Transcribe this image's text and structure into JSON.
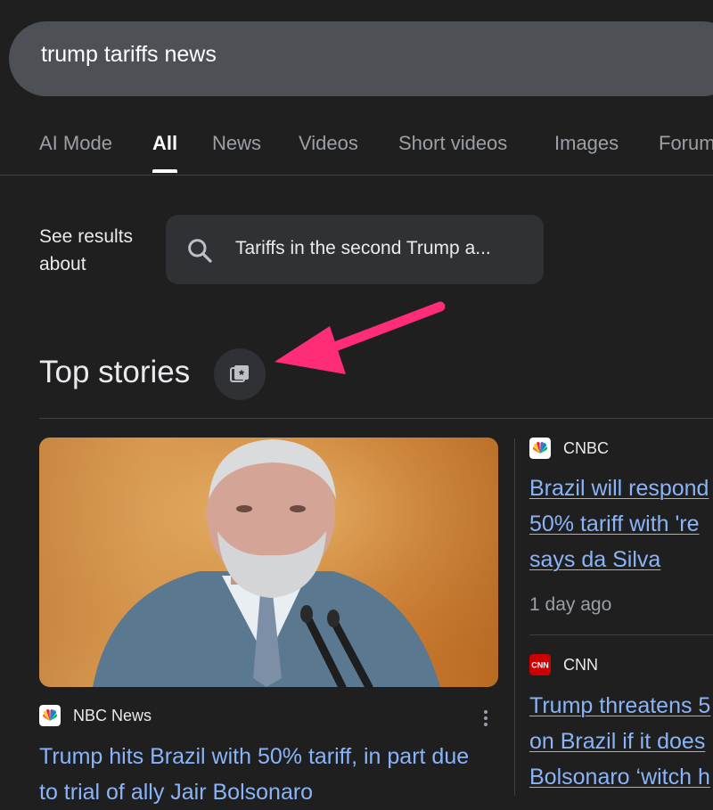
{
  "search": {
    "query": "trump tariffs news"
  },
  "tabs": [
    {
      "label": "AI Mode",
      "active": false
    },
    {
      "label": "All",
      "active": true
    },
    {
      "label": "News",
      "active": false
    },
    {
      "label": "Videos",
      "active": false
    },
    {
      "label": "Short videos",
      "active": false
    },
    {
      "label": "Images",
      "active": false
    },
    {
      "label": "Forum",
      "active": false
    }
  ],
  "see_results": {
    "label_line1": "See results",
    "label_line2": "about",
    "chip_text": "Tariffs in the second Trump a...",
    "chip_icon": "search-icon"
  },
  "top_stories": {
    "title": "Top stories",
    "button_icon": "stories-collection-icon",
    "annotation_arrow_color": "#ff2d78"
  },
  "stories": [
    {
      "source": "NBC News",
      "logo": "nbc-peacock-icon",
      "headline_line1": "Trump hits Brazil with 50% tariff, in part due",
      "headline_line2": "to trial of ally Jair Bolsonaro",
      "image": "photo of Luiz Inácio Lula da Silva speaking at microphones"
    },
    {
      "source": "CNBC",
      "logo": "cnbc-peacock-icon",
      "headline_line1": "Brazil will respond",
      "headline_line2": "50% tariff with 're",
      "headline_line3": "says da Silva",
      "time": "1 day ago"
    },
    {
      "source": "CNN",
      "logo": "cnn-logo",
      "logo_color": "#cc0000",
      "headline_line1": "Trump threatens 5",
      "headline_line2": "on Brazil if it does",
      "headline_line3": "Bolsonaro ‘witch h"
    }
  ],
  "colors": {
    "background": "#1f1f1f",
    "link": "#8ab4f8",
    "search_bar": "#4d5156",
    "chip": "#303134"
  }
}
